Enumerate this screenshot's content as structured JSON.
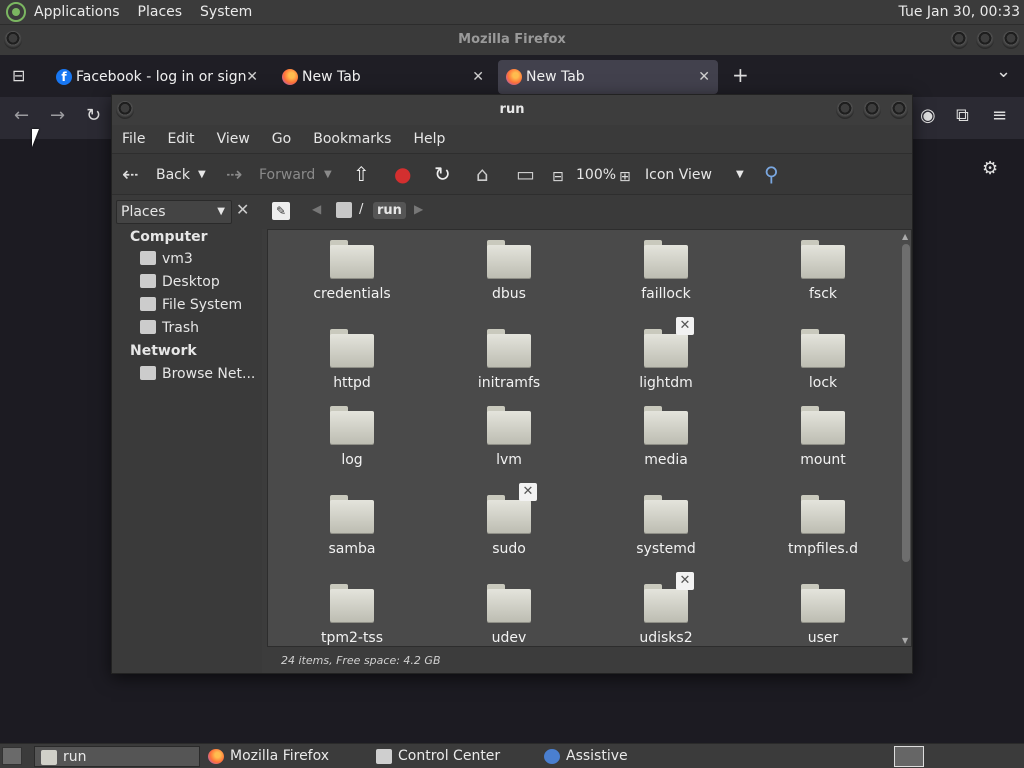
{
  "top_panel": {
    "menus": [
      "Applications",
      "Places",
      "System"
    ],
    "clock": "Tue Jan 30, 00:33"
  },
  "firefox": {
    "title": "Mozilla Firefox",
    "tabs": [
      {
        "label": "Facebook - log in or sign up",
        "icon": "facebook-icon",
        "active": false
      },
      {
        "label": "New Tab",
        "icon": "firefox-icon",
        "active": false
      },
      {
        "label": "New Tab",
        "icon": "firefox-icon",
        "active": true
      }
    ],
    "new_tab_glyph": "+",
    "tab_list_glyph": "⌄"
  },
  "caja": {
    "title": "run",
    "menu": [
      "File",
      "Edit",
      "View",
      "Go",
      "Bookmarks",
      "Help"
    ],
    "toolbar": {
      "back": "Back",
      "forward": "Forward",
      "zoom": "100%",
      "view_mode": "Icon View"
    },
    "sidebar": {
      "selector": "Places",
      "sections": [
        {
          "heading": "Computer",
          "items": [
            "vm3",
            "Desktop",
            "File System",
            "Trash"
          ]
        },
        {
          "heading": "Network",
          "items": [
            "Browse Net..."
          ]
        }
      ]
    },
    "path": {
      "segment": "run",
      "separator": "/"
    },
    "files": [
      {
        "name": "credentials",
        "locked": false
      },
      {
        "name": "dbus",
        "locked": false
      },
      {
        "name": "faillock",
        "locked": false
      },
      {
        "name": "fsck",
        "locked": false
      },
      {
        "name": "httpd",
        "locked": false
      },
      {
        "name": "initramfs",
        "locked": false
      },
      {
        "name": "lightdm",
        "locked": true
      },
      {
        "name": "lock",
        "locked": false
      },
      {
        "name": "log",
        "locked": false
      },
      {
        "name": "lvm",
        "locked": false
      },
      {
        "name": "media",
        "locked": false
      },
      {
        "name": "mount",
        "locked": false
      },
      {
        "name": "samba",
        "locked": false
      },
      {
        "name": "sudo",
        "locked": true
      },
      {
        "name": "systemd",
        "locked": false
      },
      {
        "name": "tmpfiles.d",
        "locked": false
      },
      {
        "name": "tpm2-tss",
        "locked": false
      },
      {
        "name": "udev",
        "locked": false
      },
      {
        "name": "udisks2",
        "locked": true
      },
      {
        "name": "user",
        "locked": false
      }
    ],
    "status": "24 items, Free space: 4.2 GB"
  },
  "taskbar": {
    "tasks": [
      {
        "label": "run",
        "active": true
      },
      {
        "label": "Mozilla Firefox",
        "active": false
      },
      {
        "label": "Control Center",
        "active": false
      },
      {
        "label": "Assistive Technologi...",
        "active": false
      }
    ]
  }
}
